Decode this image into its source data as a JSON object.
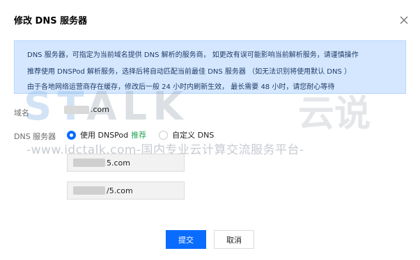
{
  "dialog": {
    "title": "修改 DNS 服务器",
    "close_icon": "close-icon"
  },
  "notice": {
    "line1": "DNS 服务器，可指定为当前域名提供 DNS 解析的服务商， 如更改有误可能影响当前解析服务，请谨慎操作",
    "line2": "推荐使用 DNSPod 解析服务，选择后将自动匹配当前最佳 DNS 服务器 （如无法识别将使用默认 DNS ）",
    "line3": "由于各地网络运营商存在缓存，修改后一般 24 小时内刷新生效， 最长需要 48 小时，请您耐心等待"
  },
  "form": {
    "domain_label": "域名",
    "domain_suffix": ".com",
    "dns_label": "DNS 服务器",
    "options": [
      {
        "label": "使用 DNSPod",
        "badge": "推荐",
        "selected": true
      },
      {
        "label": "自定义 DNS",
        "selected": false
      }
    ],
    "nameservers": [
      {
        "suffix": "5.com"
      },
      {
        "suffix": "/5.com"
      }
    ]
  },
  "buttons": {
    "submit": "提交",
    "cancel": "取消"
  },
  "watermark": {
    "logo_left": "ST",
    "logo_right": "ALK",
    "logo_cn": "云说",
    "url": "-www.idctalk.com-国内专业云计算交流服务平台-"
  },
  "colors": {
    "primary": "#0a6cff",
    "notice_bg": "#d4e7ff",
    "recommend": "#2aa55a"
  }
}
